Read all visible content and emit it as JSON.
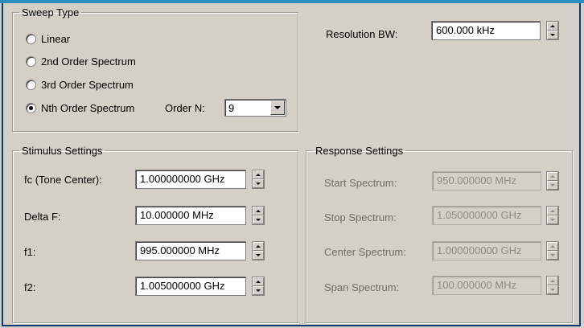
{
  "sweep_type": {
    "legend": "Sweep Type",
    "options": [
      {
        "label": "Linear",
        "checked": false
      },
      {
        "label": "2nd Order Spectrum",
        "checked": false
      },
      {
        "label": "3rd Order Spectrum",
        "checked": false
      },
      {
        "label": "Nth Order Spectrum",
        "checked": true
      }
    ],
    "order_label": "Order N:",
    "order_value": "9"
  },
  "resolution_bw": {
    "label": "Resolution BW:",
    "value": "600.000 kHz"
  },
  "stimulus": {
    "legend": "Stimulus Settings",
    "fields": [
      {
        "label": "fc (Tone Center):",
        "value": "1.000000000 GHz"
      },
      {
        "label": "Delta F:",
        "value": "10.000000 MHz"
      },
      {
        "label": "f1:",
        "value": "995.000000 MHz"
      },
      {
        "label": "f2:",
        "value": "1.005000000 GHz"
      }
    ]
  },
  "response": {
    "legend": "Response Settings",
    "fields": [
      {
        "label": "Start Spectrum:",
        "value": "950.000000 MHz"
      },
      {
        "label": "Stop Spectrum:",
        "value": "1.050000000 GHz"
      },
      {
        "label": "Center Spectrum:",
        "value": "1.000000000 GHz"
      },
      {
        "label": "Span Spectrum:",
        "value": "100.000000 MHz"
      }
    ]
  },
  "colors": {
    "dialog_bg": "#d4d0c8",
    "title_accent": "#2a8fc0",
    "frame": "#0d3b78",
    "disabled_text": "#8e8b86"
  }
}
